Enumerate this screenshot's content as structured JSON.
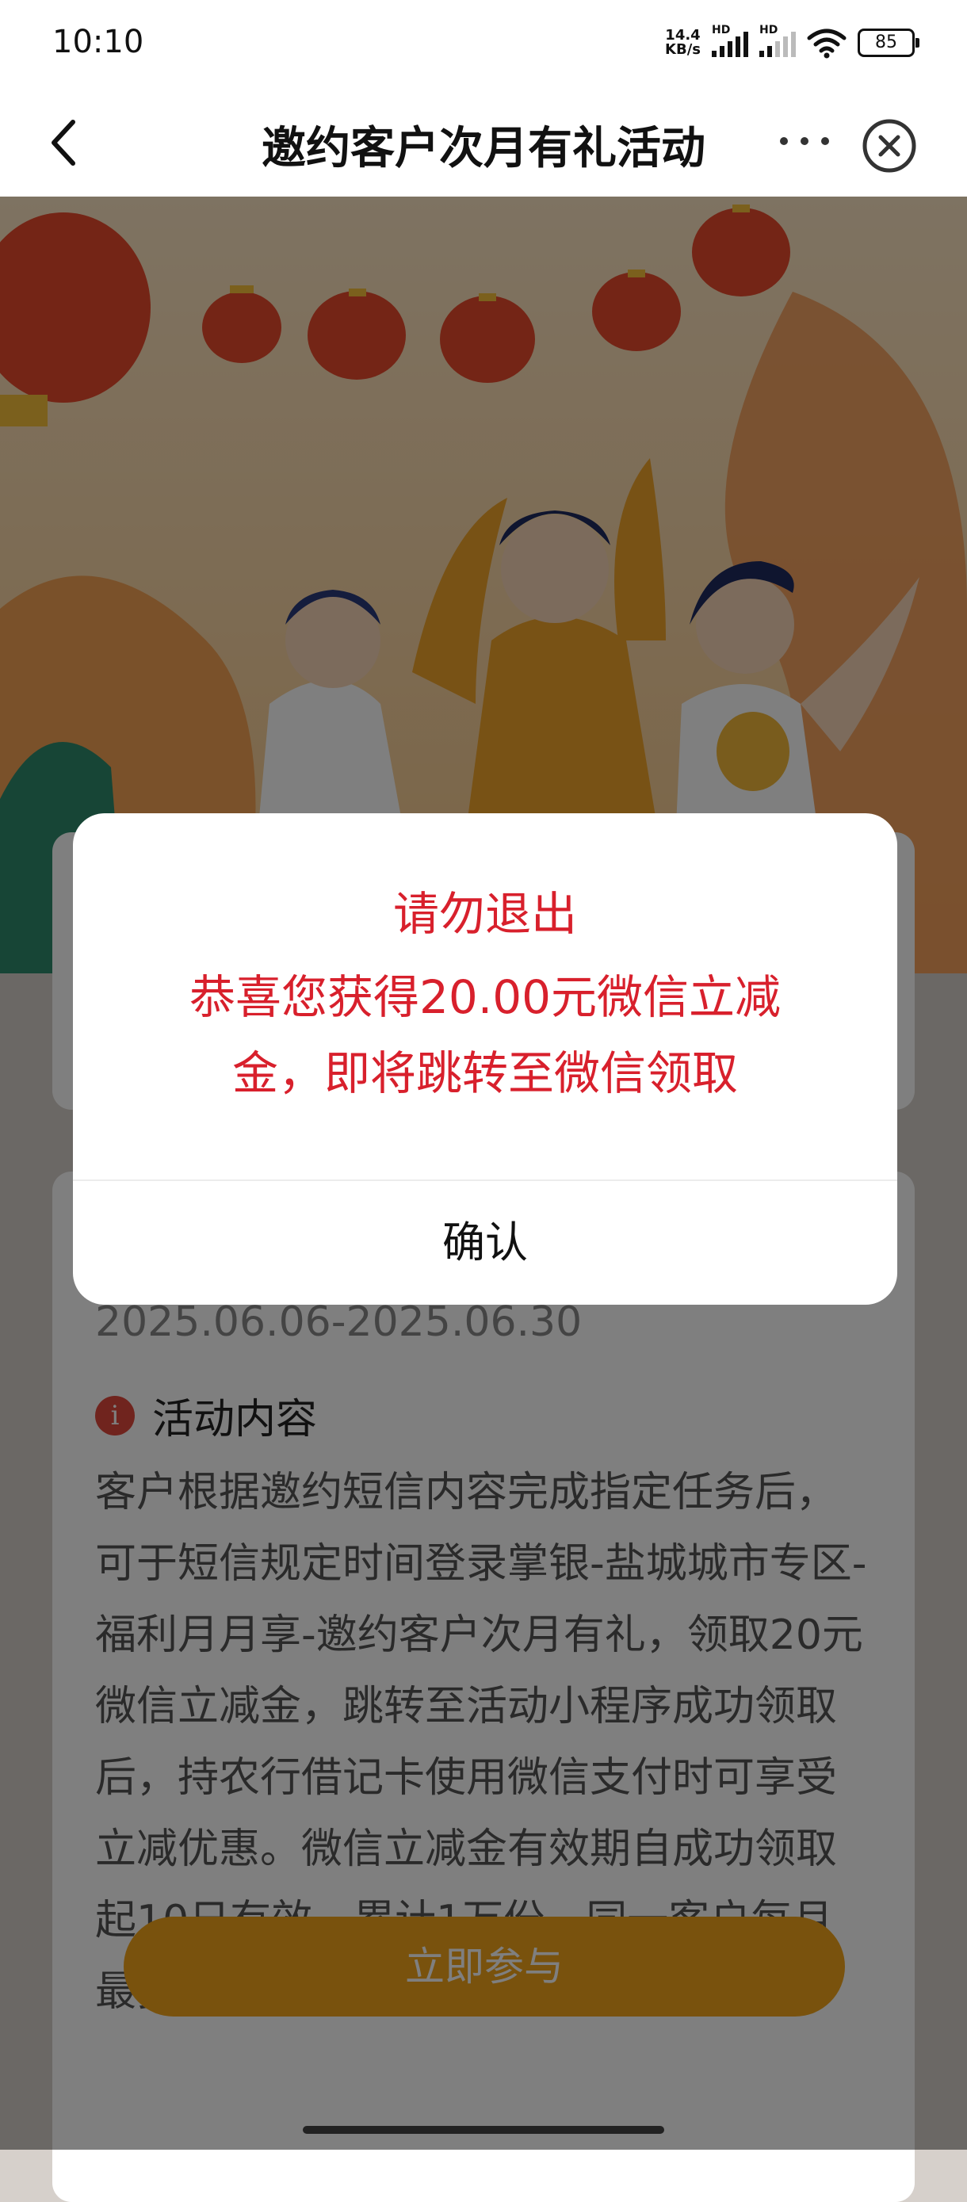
{
  "status_bar": {
    "time": "10:10",
    "net_speed": "14.4",
    "net_unit": "KB/s",
    "sim1_label": "HD",
    "sim2_label": "HD",
    "battery": "85"
  },
  "nav": {
    "title": "邀约客户次月有礼活动",
    "back_icon": "chevron-left-icon",
    "more_icon": "more-dots-icon",
    "close_icon": "close-circle-icon"
  },
  "content": {
    "activity_period": "2025.06.06-2025.06.30",
    "section_title": "活动内容",
    "description": "客户根据邀约短信内容完成指定任务后，可于短信规定时间登录掌银-盐城城市专区-福利月月享-邀约客户次月有礼，领取20元微信立减金，跳转至活动小程序成功领取后，持农行借记卡使用微信支付时可享受立减优惠。微信立减金有效期自成功领取起10日有效，累计1万份。同一客户每月最多领取1",
    "cta_label": "立即参与"
  },
  "dialog": {
    "title": "请勿退出",
    "message": "恭喜您获得20.00元微信立减金，即将跳转至微信领取",
    "confirm_label": "确认"
  },
  "colors": {
    "dialog_text": "#d8202c",
    "cta": "#f2a51a",
    "info_icon": "#e0483c"
  }
}
